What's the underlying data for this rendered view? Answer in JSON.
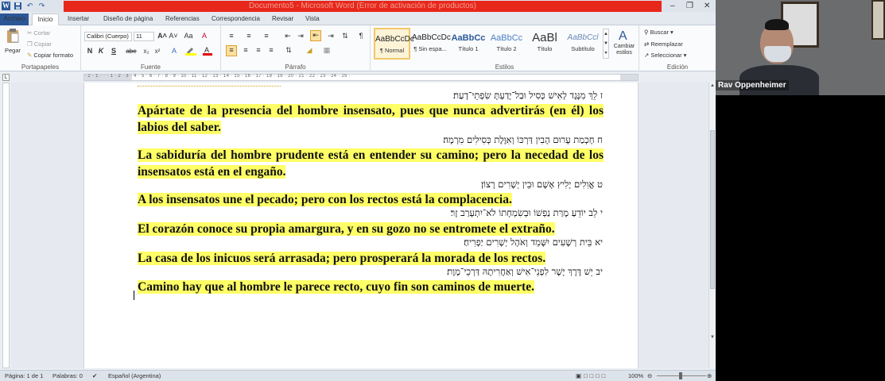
{
  "window": {
    "title": "Documento5 - Microsoft Word (Error de activación de productos)",
    "controls": [
      "–",
      "❐",
      "✕"
    ]
  },
  "qat": {
    "word_icon": "W",
    "save_icon": "save-icon",
    "undo_icon": "↶",
    "redo_icon": "↷"
  },
  "tabs": [
    {
      "label": "Archivo"
    },
    {
      "label": "Inicio"
    },
    {
      "label": "Insertar"
    },
    {
      "label": "Diseño de página"
    },
    {
      "label": "Referencias"
    },
    {
      "label": "Correspondencia"
    },
    {
      "label": "Revisar"
    },
    {
      "label": "Vista"
    }
  ],
  "ribbon": {
    "portapapeles": {
      "label": "Portapapeles",
      "paste": "Pegar",
      "cut": "Cortar",
      "copy": "Copiar",
      "format_painter": "Copiar formato"
    },
    "fuente": {
      "label": "Fuente",
      "font_name": "Calibri (Cuerpo)",
      "font_size": "11",
      "bold": "N",
      "italic": "K",
      "underline": "S",
      "strike": "abe",
      "subscript": "x₂",
      "superscript": "x²",
      "grow": "A˄",
      "shrink": "A˅",
      "case": "Aa",
      "clear": "A"
    },
    "parrafo": {
      "label": "Párrafo",
      "pilcrow": "¶"
    },
    "estilos": {
      "label": "Estilos",
      "items": [
        {
          "preview": "AaBbCcDc",
          "name": "¶ Normal"
        },
        {
          "preview": "AaBbCcDc",
          "name": "¶ Sin espa..."
        },
        {
          "preview": "AaBbCc",
          "name": "Título 1"
        },
        {
          "preview": "AaBbCc",
          "name": "Título 2"
        },
        {
          "preview": "AaBl",
          "name": "Título"
        },
        {
          "preview": "AaBbCcl",
          "name": "Subtítulo"
        }
      ],
      "change": "Cambiar estilos"
    },
    "edicion": {
      "label": "Edición",
      "find": "Buscar",
      "replace": "Reemplazar",
      "select": "Seleccionar"
    }
  },
  "ruler": {
    "numbers": "· 2 · 1 · · · 1 · 2 · 3 · 4 · 5 · 6 · 7 · 8 · 9 · 10 · 11 · 12 · 13 · 14 · 15 · 16 · 17 · 18 · 19 · 20 · 21 · 22 · 23 · 24 · 25 ·"
  },
  "document": {
    "verses": [
      {
        "hebrew": "ז לֵךְ מִנֶּגֶד לְאִישׁ כְּסִיל וּבַל־יָדַעְתָּ שִׂפְתֵי־דָעַת׃",
        "spanish": "Apártate de la presencia del hombre insensato, pues que nunca advertirás (en él) los labios del saber."
      },
      {
        "hebrew": "ח חָכְמַת עָרוּם הָבִין דַּרְכּוֹ וְאִוֶּלֶת כְּסִילִים מִרְמָה׃",
        "spanish": "La sabiduría del hombre prudente está en entender su camino; pero la necedad de los insensatos está en el engaño."
      },
      {
        "hebrew": "ט אֱוִלִים יָלִיץ אָשָׁם וּבֵין יְשָׁרִים רָצוֹן׃",
        "spanish": "A los insensatos une el pecado; pero con los rectos está la complacencia."
      },
      {
        "hebrew": "י לֵב יוֹדֵעַ מָרַּת נַפְשׁוֹ וּבְשִׂמְחָתוֹ לֹא־יִתְעָרַב זָר׃",
        "spanish": "El corazón conoce su propia amargura, y en su gozo no se entromete el extraño."
      },
      {
        "hebrew": "יא בֵּית רְשָׁעִים יִשָּׁמֵד וְאֹהֶל יְשָׁרִים יַפְרִיחַ׃",
        "spanish": "La casa de los inicuos será arrasada; pero prosperará la morada de los rectos."
      },
      {
        "hebrew": "יב יֵשׁ דֶּרֶךְ יָשָׁר לִפְנֵי־אִישׁ וְאַחֲרִיתָהּ דַּרְכֵי־מָוֶת׃",
        "spanish": "Camino hay que al hombre le parece recto, cuyo fin son caminos de muerte."
      }
    ]
  },
  "statusbar": {
    "page": "Página: 1 de 1",
    "words": "Palabras: 0",
    "language": "Español (Argentina)",
    "zoom": "100%"
  },
  "video": {
    "name": "Rav Oppenheimer"
  },
  "colors": {
    "title_red": "#e8271b",
    "file_tab": "#2b5797",
    "highlight": "#ffff66"
  }
}
